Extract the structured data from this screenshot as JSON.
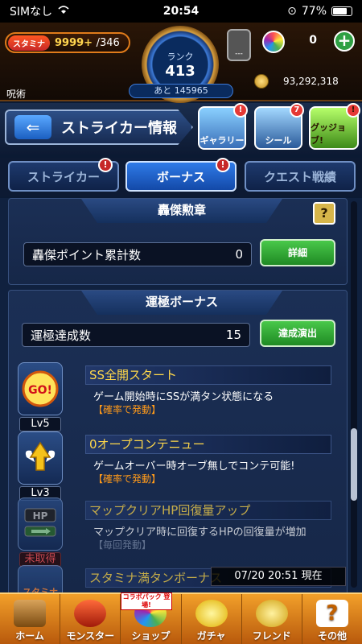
{
  "status": {
    "carrier": "SIMなし",
    "time": "20:54",
    "battery": "77%",
    "battery_level": 0.77
  },
  "header": {
    "stamina_label": "スタミナ",
    "stamina_current": "9999+",
    "stamina_max": "/346",
    "rank_label": "ランク",
    "rank": "413",
    "rank_next": "あと 145965",
    "medal_label": "---",
    "orbs": "0",
    "plus_label": "+",
    "title": "呪術",
    "gold": "93,292,318"
  },
  "banner": {
    "back_label": "⇐",
    "title": "ストライカー情報",
    "shortcuts": [
      {
        "label": "ギャラリー",
        "badge": "!"
      },
      {
        "label": "シール",
        "badge": "7"
      },
      {
        "label": "グッジョブ!",
        "badge": "!"
      }
    ]
  },
  "tabs": [
    {
      "label": "ストライカー",
      "alert": "!"
    },
    {
      "label": "ボーナス",
      "alert": "!"
    },
    {
      "label": "クエスト戦績"
    }
  ],
  "section1": {
    "heading": "轟傑勲章",
    "help": "?",
    "stat_label": "轟傑ポイント累計数",
    "stat_value": "0",
    "button": "詳細"
  },
  "section2": {
    "heading": "運極ボーナス",
    "stat_label": "運極達成数",
    "stat_value": "15",
    "button": "達成演出"
  },
  "bonuses": [
    {
      "icon_text": "GO!",
      "level": "Lv5",
      "name": "SS全開スタート",
      "desc": "ゲーム開始時にSSが満タン状態になる",
      "note": "【確率で発動】"
    },
    {
      "icon_text": "↑",
      "level": "Lv3",
      "name": "0オープコンテニュー",
      "desc": "ゲームオーバー時オーブ無しでコンテ可能!",
      "note": "【確率で発動】"
    },
    {
      "icon_text": "HP",
      "level": "未取得",
      "name": "マップクリアHP回復量アップ",
      "desc": "マップクリア時に回復するHPの回復量が増加",
      "note": "【毎回発動】"
    },
    {
      "icon_text": "スタミナ",
      "level": "",
      "name": "スタミナ満タンボーナス",
      "desc": "",
      "note": ""
    }
  ],
  "timestamp": "07/20 20:51 現在",
  "nav": {
    "collab_badge": "コラボパック 登場!",
    "items": [
      "ホーム",
      "モンスター",
      "ショップ",
      "ガチャ",
      "フレンド",
      "その他"
    ]
  }
}
